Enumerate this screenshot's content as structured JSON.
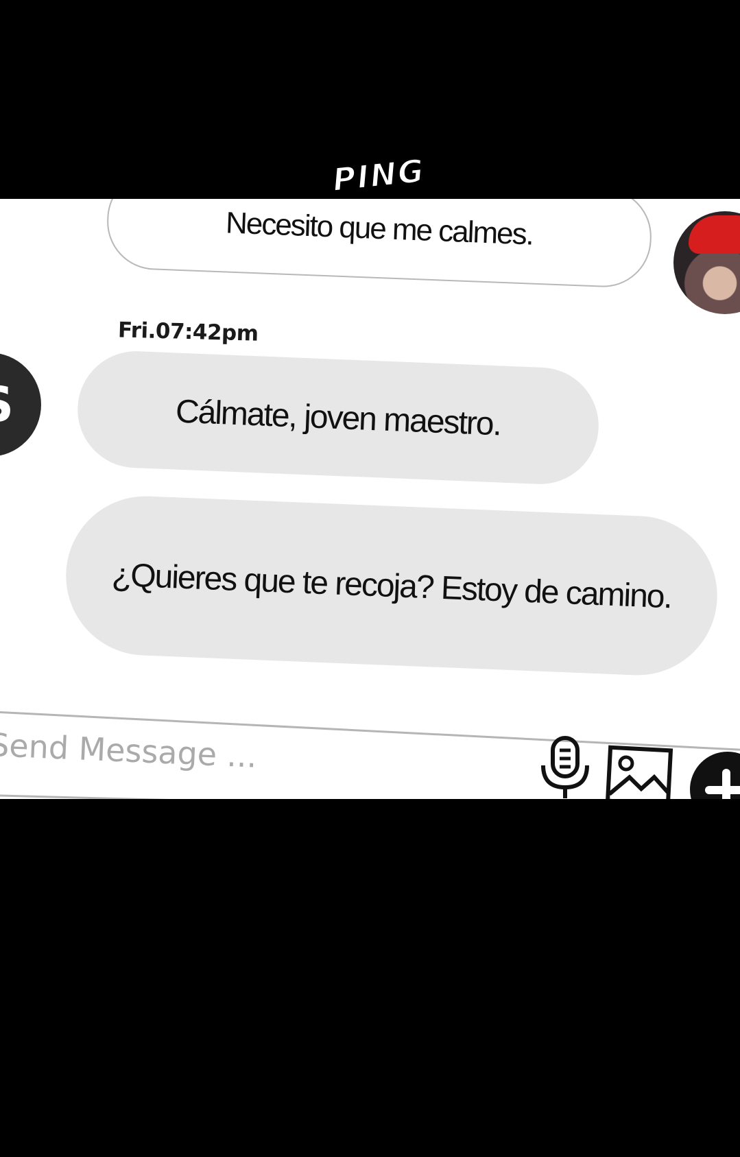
{
  "sound_effect": "PING",
  "chat": {
    "messages": [
      {
        "direction": "outgoing",
        "text": "Necesito que me calmes."
      },
      {
        "direction": "incoming",
        "text": "Cálmate, joven maestro."
      },
      {
        "direction": "incoming",
        "text": "¿Quieres que te recoja? Estoy de camino."
      }
    ],
    "timestamp": "Fri.07:42pm",
    "contact_avatar_letter": "S"
  },
  "composer": {
    "placeholder": "Send Message ..."
  },
  "icons": {
    "mic": "microphone-icon",
    "gallery": "image-icon",
    "plus": "plus-icon"
  },
  "colors": {
    "incoming_bubble": "#e7e7e7",
    "outgoing_border": "#b8b8b8",
    "background": "#000000",
    "panel": "#ffffff"
  }
}
